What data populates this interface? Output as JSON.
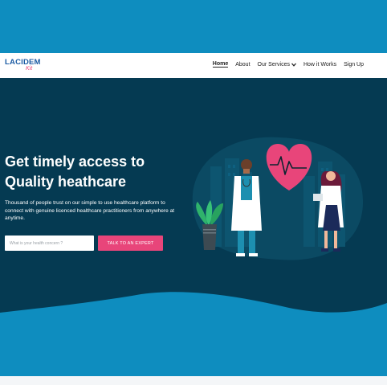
{
  "header": {
    "logo_main": "LACIDEM",
    "logo_sub": "Kit"
  },
  "nav": {
    "items": [
      {
        "label": "Home",
        "active": true
      },
      {
        "label": "About",
        "active": false
      },
      {
        "label": "Our Services",
        "active": false,
        "has_dropdown": true
      },
      {
        "label": "How it Works",
        "active": false
      },
      {
        "label": "Sign Up",
        "active": false
      }
    ]
  },
  "hero": {
    "title_line1": "Get timely access to",
    "title_line2": "Quality heathcare",
    "description": "Thousand of people trust on our simple to use healthcare platform to connect with genuine licenced healthcare practitioners from anywhere at anytime.",
    "search_placeholder": "What is your health concern ?",
    "cta_label": "TALK TO AN EXPERT"
  },
  "colors": {
    "top_band": "#0e8dbf",
    "hero_bg": "#053a52",
    "accent_pink": "#e8457a",
    "logo_blue": "#1a5aa3"
  },
  "icons": [
    "heart-pulse-icon",
    "chevron-down-icon",
    "plant-icon"
  ]
}
